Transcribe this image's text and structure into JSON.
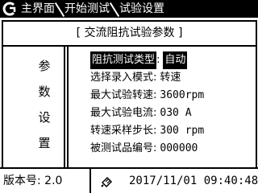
{
  "titlebar": {
    "breadcrumb": [
      "主界面",
      "开始测试",
      "试验设置"
    ]
  },
  "panel": {
    "header": "[ 交流阻抗试验参数 ]",
    "side_label": [
      "参",
      "数",
      "设",
      "置"
    ],
    "params": [
      {
        "label": "阻抗测试类型",
        "value": "自动",
        "selected": true
      },
      {
        "label": "选择录入模式",
        "value": "转速"
      },
      {
        "label": "最大试验转速",
        "value": "3600rpm"
      },
      {
        "label": "最大试验电流",
        "value": "030 A"
      },
      {
        "label": "转速采样步长",
        "value": "300 rpm"
      },
      {
        "label": "被测试品编号",
        "value": "000000"
      }
    ]
  },
  "footer": {
    "version": "版本号: 2.0",
    "datetime": "2017/11/01 09:40:48",
    "usb_icon": "usb-icon"
  },
  "colors": {
    "foreground": "#000000",
    "background": "#ffffff"
  },
  "icons": {
    "logo": "brand-logo-icon"
  }
}
